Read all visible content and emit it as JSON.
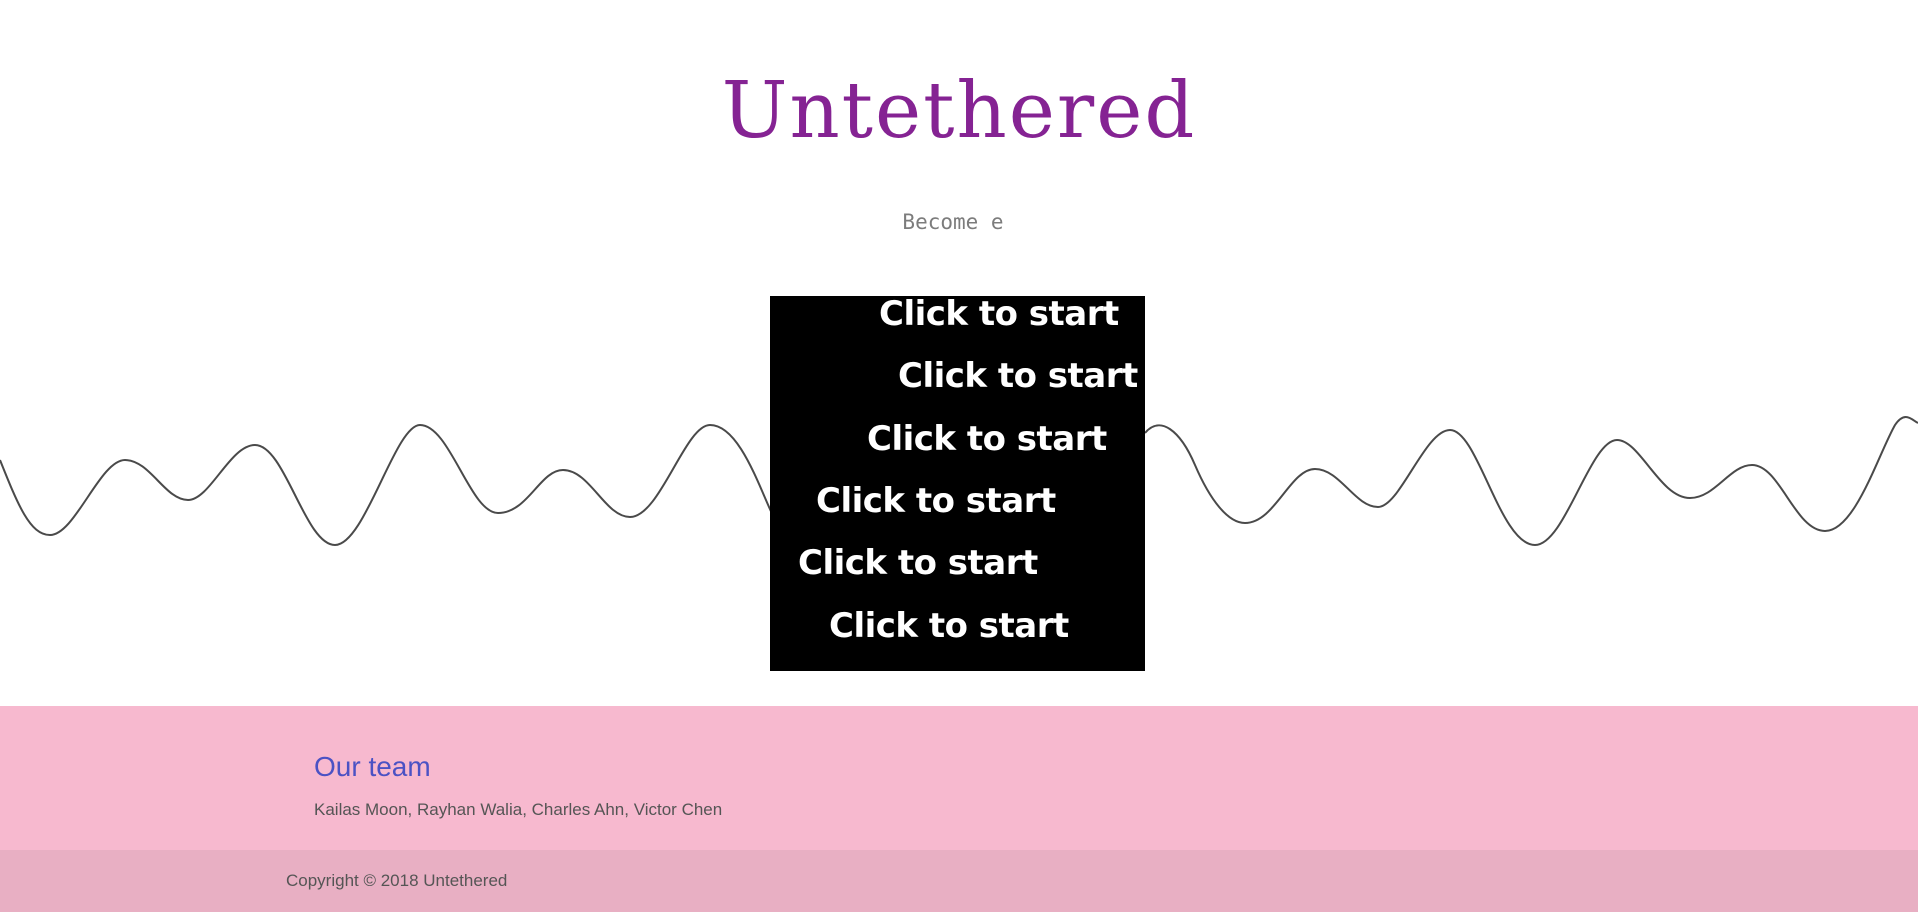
{
  "header": {
    "title": "Untethered",
    "tagline": "Become e"
  },
  "game": {
    "start_labels": [
      "Click to start",
      "Click to start",
      "Click to start",
      "Click to start",
      "Click to start",
      "Click to start"
    ]
  },
  "footer": {
    "team_heading": "Our team",
    "team_members": "Kailas Moon, Rayhan Walia, Charles Ahn, Victor Chen",
    "copyright": "Copyright © 2018 Untethered"
  },
  "colors": {
    "title": "#852393",
    "footer_top": "#f7b9cf",
    "footer_bottom": "#e8afc3",
    "team_heading": "#4b52c4",
    "game_bg": "#000000",
    "wave_stroke": "#4a4a4a"
  }
}
